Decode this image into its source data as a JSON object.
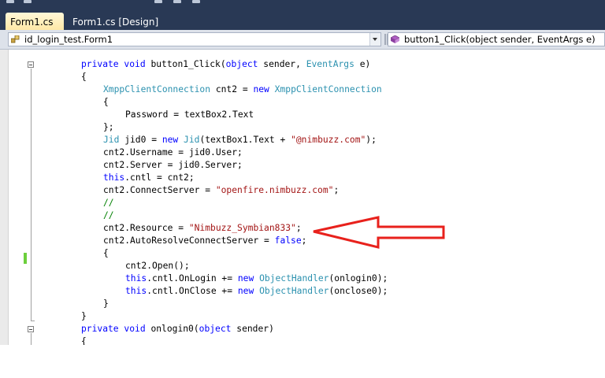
{
  "tabs": [
    {
      "label": "Form1.cs",
      "active": true
    },
    {
      "label": "Form1.cs [Design]",
      "active": false
    }
  ],
  "navbar": {
    "type_selector": "id_login_test.Form1",
    "member_selector": "button1_Click(object sender, EventArgs e)"
  },
  "code": {
    "l0": {
      "p1": "private",
      "p2": " ",
      "p3": "void",
      "p4": " button1_Click(",
      "p5": "object",
      "p6": " sender, ",
      "p7": "EventArgs",
      "p8": " e)"
    },
    "l1": {
      "p1": "{"
    },
    "l2": {
      "p1": "XmppClientConnection",
      "p2": " cnt2 = ",
      "p3": "new",
      "p4": " ",
      "p5": "XmppClientConnection"
    },
    "l3": {
      "p1": "{"
    },
    "l4": {
      "p1": "Password = textBox2.Text"
    },
    "l5": {
      "p1": "};"
    },
    "l6": {
      "p1": "Jid",
      "p2": " jid0 = ",
      "p3": "new",
      "p4": " ",
      "p5": "Jid",
      "p6": "(textBox1.Text + ",
      "p7": "\"@nimbuzz.com\"",
      "p8": ");"
    },
    "l7": {
      "p1": "cnt2.Username = jid0.User;"
    },
    "l8": {
      "p1": "cnt2.Server = jid0.Server;"
    },
    "l9": {
      "p1": "this",
      "p2": ".cntl = cnt2;"
    },
    "l10": {
      "p1": "cnt2.ConnectServer = ",
      "p2": "\"openfire.nimbuzz.com\"",
      "p3": ";"
    },
    "l11": {
      "p1": "//"
    },
    "l12": {
      "p1": "//"
    },
    "l13": {
      "p1": "cnt2.Resource = ",
      "p2": "\"Nimbuzz_Symbian833\"",
      "p3": ";"
    },
    "l14": {
      "p1": "cnt2.AutoResolveConnectServer = ",
      "p2": "false",
      "p3": ";"
    },
    "l15": {
      "p1": "{"
    },
    "l16": {
      "p1": "cnt2.Open();"
    },
    "l17": {
      "p1": "this",
      "p2": ".cntl.OnLogin += ",
      "p3": "new",
      "p4": " ",
      "p5": "ObjectHandler",
      "p6": "(onlogin0);"
    },
    "l18": {
      "p1": "this",
      "p2": ".cntl.OnClose += ",
      "p3": "new",
      "p4": " ",
      "p5": "ObjectHandler",
      "p6": "(onclose0);"
    },
    "l19": {
      "p1": "}"
    },
    "l20": {
      "p1": "}"
    },
    "l21": {
      "p1": "private",
      "p2": " ",
      "p3": "void",
      "p4": " onlogin0(",
      "p5": "object",
      "p6": " sender)"
    },
    "l22": {
      "p1": "{"
    }
  },
  "colors": {
    "keyword": "#0000ff",
    "type": "#2b91af",
    "string": "#a31515",
    "comment": "#008000",
    "annotation_arrow": "#e8211c",
    "ide_chrome": "#293955"
  },
  "icons": [
    "class-icon",
    "method-icon",
    "collapse-icon",
    "dropdown-arrow-icon",
    "annotation-arrow"
  ]
}
